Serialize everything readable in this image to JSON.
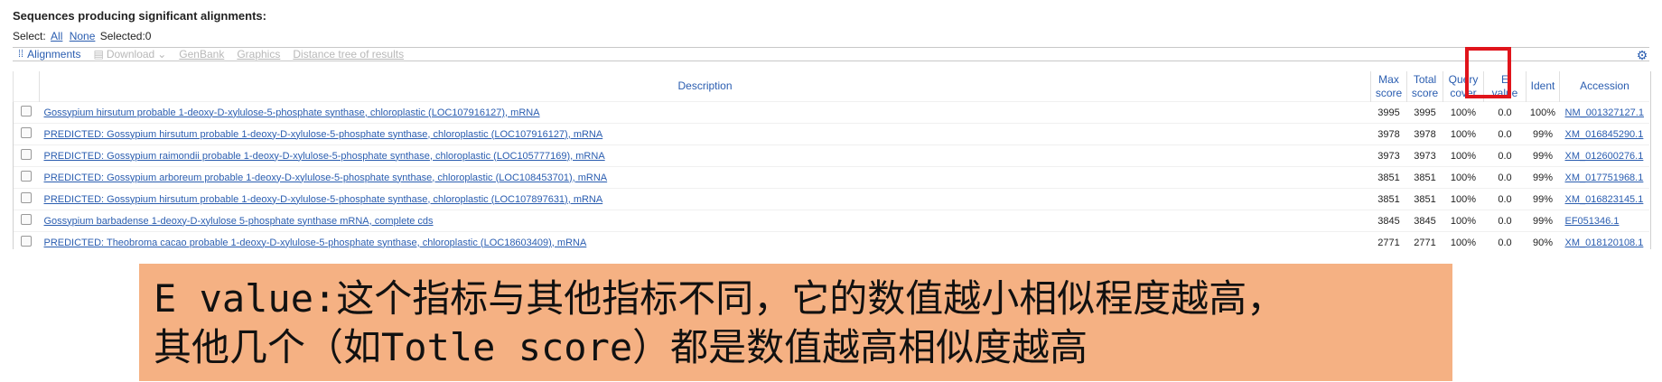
{
  "heading": "Sequences producing significant alignments:",
  "select": {
    "label": "Select:",
    "all": "All",
    "none": "None",
    "selected": "Selected:0"
  },
  "toolbar": {
    "alignments": "Alignments",
    "download": "Download",
    "genbank": "GenBank",
    "graphics": "Graphics",
    "distance_tree": "Distance tree of results"
  },
  "columns": {
    "description": "Description",
    "max_score_1": "Max",
    "max_score_2": "score",
    "total_score_1": "Total",
    "total_score_2": "score",
    "query_cover_1": "Query",
    "query_cover_2": "cover",
    "e_value_1": "E",
    "e_value_2": "value",
    "ident": "Ident",
    "accession": "Accession"
  },
  "rows": [
    {
      "description": "Gossypium hirsutum probable 1-deoxy-D-xylulose-5-phosphate synthase, chloroplastic (LOC107916127), mRNA",
      "max_score": "3995",
      "total_score": "3995",
      "query_cover": "100%",
      "e_value": "0.0",
      "ident": "100%",
      "accession": "NM_001327127.1"
    },
    {
      "description": "PREDICTED: Gossypium hirsutum probable 1-deoxy-D-xylulose-5-phosphate synthase, chloroplastic (LOC107916127), mRNA",
      "max_score": "3978",
      "total_score": "3978",
      "query_cover": "100%",
      "e_value": "0.0",
      "ident": "99%",
      "accession": "XM_016845290.1"
    },
    {
      "description": "PREDICTED: Gossypium raimondii probable 1-deoxy-D-xylulose-5-phosphate synthase, chloroplastic (LOC105777169), mRNA",
      "max_score": "3973",
      "total_score": "3973",
      "query_cover": "100%",
      "e_value": "0.0",
      "ident": "99%",
      "accession": "XM_012600276.1"
    },
    {
      "description": "PREDICTED: Gossypium arboreum probable 1-deoxy-D-xylulose-5-phosphate synthase, chloroplastic (LOC108453701), mRNA",
      "max_score": "3851",
      "total_score": "3851",
      "query_cover": "100%",
      "e_value": "0.0",
      "ident": "99%",
      "accession": "XM_017751968.1"
    },
    {
      "description": "PREDICTED: Gossypium hirsutum probable 1-deoxy-D-xylulose-5-phosphate synthase, chloroplastic (LOC107897631), mRNA",
      "max_score": "3851",
      "total_score": "3851",
      "query_cover": "100%",
      "e_value": "0.0",
      "ident": "99%",
      "accession": "XM_016823145.1"
    },
    {
      "description": "Gossypium barbadense 1-deoxy-D-xylulose 5-phosphate synthase mRNA, complete cds",
      "max_score": "3845",
      "total_score": "3845",
      "query_cover": "100%",
      "e_value": "0.0",
      "ident": "99%",
      "accession": "EF051346.1"
    },
    {
      "description": "PREDICTED: Theobroma cacao probable 1-deoxy-D-xylulose-5-phosphate synthase, chloroplastic (LOC18603409), mRNA",
      "max_score": "2771",
      "total_score": "2771",
      "query_cover": "100%",
      "e_value": "0.0",
      "ident": "90%",
      "accession": "XM_018120108.1"
    }
  ],
  "note": {
    "line1": "E value:这个指标与其他指标不同，它的数值越小相似程度越高，",
    "line2": "其他几个（如Totle score）都是数值越高相似度越高"
  },
  "colors": {
    "link": "#2a5db0",
    "highlight": "#e0141b",
    "note_bg": "#f5b183"
  },
  "icons": {
    "alignments": "alignments-icon",
    "download": "download-icon",
    "dropdown": "chevron-down-icon",
    "settings": "gear-icon"
  }
}
